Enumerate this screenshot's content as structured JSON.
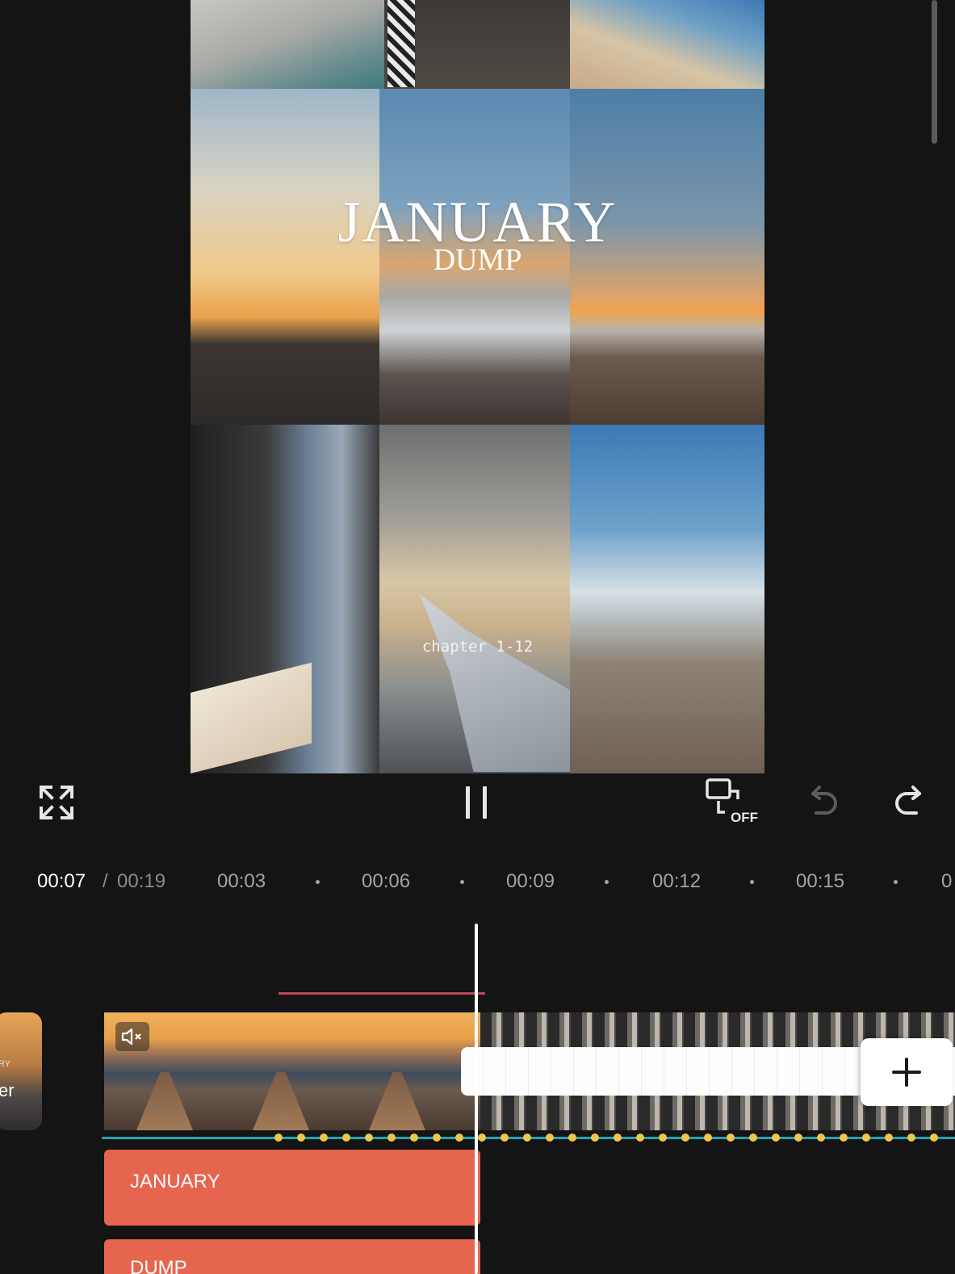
{
  "preview": {
    "title": "JANUARY",
    "subtitle": "DUMP",
    "chapter_text": "chapter 1-12"
  },
  "toolbar": {
    "fullscreen_icon": "fullscreen-icon",
    "pause_icon": "pause-icon",
    "keyframe_label": "OFF",
    "undo_icon": "undo-icon",
    "redo_icon": "redo-icon"
  },
  "time": {
    "current": "00:07",
    "separator": "/",
    "total": "00:19",
    "ticks": [
      "00:03",
      "00:06",
      "00:09",
      "00:12",
      "00:15",
      "0"
    ]
  },
  "timeline": {
    "prev_clip_text": "er",
    "prev_clip_small": "RY",
    "mute_icon": "mute-icon",
    "add_icon": "plus-icon",
    "text_tracks": [
      "JANUARY",
      "DUMP"
    ]
  },
  "colors": {
    "background": "#141414",
    "text_track": "#e6654e",
    "keyframe_line": "#1ea3b2",
    "keyframe_dot": "#f0c64b",
    "accent_red": "#c2465a"
  }
}
